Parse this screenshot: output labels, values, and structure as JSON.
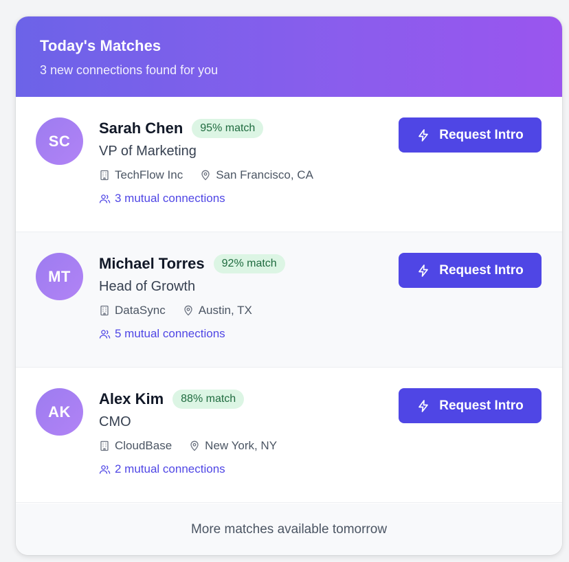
{
  "header": {
    "title": "Today's Matches",
    "subtitle": "3 new connections found for you"
  },
  "matches": [
    {
      "initials": "SC",
      "name": "Sarah Chen",
      "match": "95% match",
      "title": "VP of Marketing",
      "company": "TechFlow Inc",
      "location": "San Francisco, CA",
      "mutual": "3 mutual connections",
      "button": "Request Intro"
    },
    {
      "initials": "MT",
      "name": "Michael Torres",
      "match": "92% match",
      "title": "Head of Growth",
      "company": "DataSync",
      "location": "Austin, TX",
      "mutual": "5 mutual connections",
      "button": "Request Intro"
    },
    {
      "initials": "AK",
      "name": "Alex Kim",
      "match": "88% match",
      "title": "CMO",
      "company": "CloudBase",
      "location": "New York, NY",
      "mutual": "2 mutual connections",
      "button": "Request Intro"
    }
  ],
  "footer": {
    "text": "More matches available tomorrow"
  },
  "icons": {
    "company": "building-icon",
    "location": "map-pin-icon",
    "mutual": "users-icon",
    "button": "lightning-bolt-icon"
  },
  "colors": {
    "accent": "#4f46e5",
    "header_gradient_start": "#6c63e8",
    "header_gradient_end": "#9a55ee",
    "badge_bg": "#dcf5e4",
    "badge_text": "#1f6b3f"
  }
}
